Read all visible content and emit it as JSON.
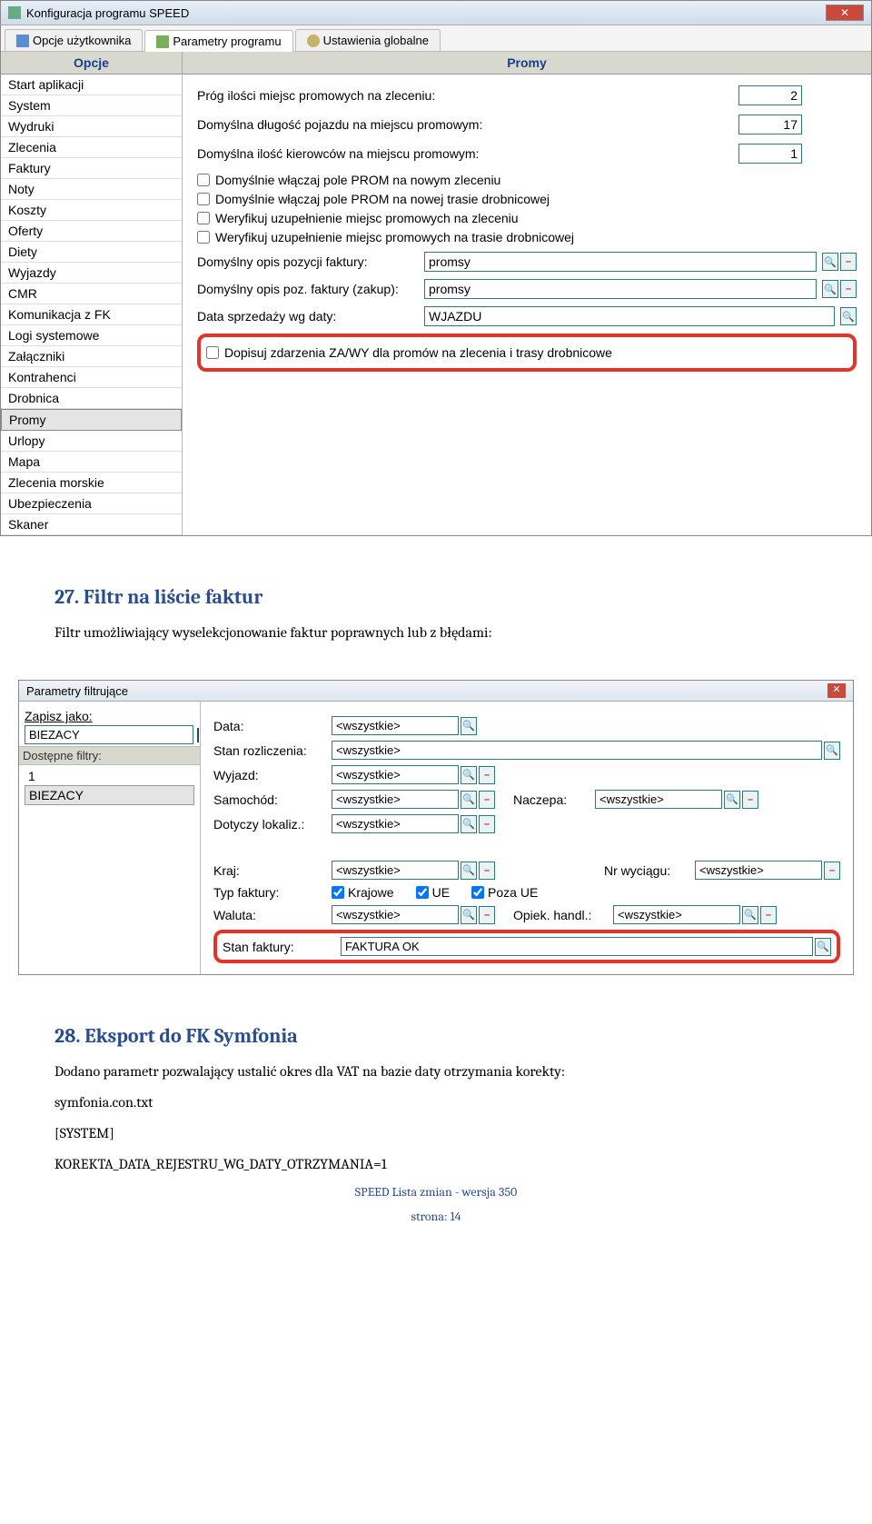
{
  "win1": {
    "title": "Konfiguracja programu SPEED",
    "tabs": [
      "Opcje użytkownika",
      "Parametry programu",
      "Ustawienia globalne"
    ],
    "col_headers": [
      "Opcje",
      "Promy"
    ],
    "sidebar": [
      "Start aplikacji",
      "System",
      "Wydruki",
      "Zlecenia",
      "Faktury",
      "Noty",
      "Koszty",
      "Oferty",
      "Diety",
      "Wyjazdy",
      "CMR",
      "Komunikacja z FK",
      "Logi systemowe",
      "Załączniki",
      "Kontrahenci",
      "Drobnica",
      "Promy",
      "Urlopy",
      "Mapa",
      "Zlecenia morskie",
      "Ubezpieczenia",
      "Skaner"
    ],
    "form": {
      "r1": {
        "label": "Próg ilości miejsc promowych na zleceniu:",
        "val": "2"
      },
      "r2": {
        "label": "Domyślna długość pojazdu na miejscu promowym:",
        "val": "17"
      },
      "r3": {
        "label": "Domyślna ilość kierowców na miejscu promowym:",
        "val": "1"
      },
      "c1": "Domyślnie włączaj pole PROM na nowym zleceniu",
      "c2": "Domyślnie włączaj pole PROM na nowej trasie drobnicowej",
      "c3": "Weryfikuj uzupełnienie miejsc promowych na zleceniu",
      "c4": "Weryfikuj uzupełnienie miejsc promowych na trasie drobnicowej",
      "t1": {
        "label": "Domyślny opis pozycji faktury:",
        "val": "promsy"
      },
      "t2": {
        "label": "Domyślny opis poz. faktury (zakup):",
        "val": "promsy"
      },
      "t3": {
        "label": "Data sprzedaży wg daty:",
        "val": "WJAZDU"
      },
      "c5": "Dopisuj zdarzenia ZA/WY dla promów na zlecenia i trasy drobnicowe"
    }
  },
  "doc": {
    "h27": "27. Filtr na liście faktur",
    "p27": "Filtr umożliwiający wyselekcjonowanie faktur poprawnych lub z błędami:",
    "h28": "28. Eksport do FK Symfonia",
    "p28a": "Dodano parametr pozwalający ustalić okres dla VAT na bazie daty otrzymania korekty:",
    "p28b": "symfonia.con.txt",
    "p28c": "[SYSTEM]",
    "p28d": "KOREKTA_DATA_REJESTRU_WG_DATY_OTRZYMANIA=1",
    "footer1": "SPEED Lista zmian - wersja 350",
    "footer2": "strona: 14"
  },
  "win2": {
    "title": "Parametry filtrujące",
    "side": {
      "zapisz": "Zapisz jako:",
      "biezacy": "BIEZACY",
      "dostepne": "Dostępne filtry:",
      "items": [
        "1",
        "BIEZACY"
      ]
    },
    "main": {
      "all": "<wszystkie>",
      "data": "Data:",
      "stan_roz": "Stan rozliczenia:",
      "wyjazd": "Wyjazd:",
      "samochod": "Samochód:",
      "naczepa": "Naczepa:",
      "dotyczy": "Dotyczy lokaliz.:",
      "kraj": "Kraj:",
      "nr_wyc": "Nr wyciągu:",
      "typ_fak": "Typ faktury:",
      "krajowe": "Krajowe",
      "ue": "UE",
      "poza_ue": "Poza UE",
      "waluta": "Waluta:",
      "opiek": "Opiek. handl.:",
      "stan_fak": "Stan faktury:",
      "faktura_ok": "FAKTURA OK"
    }
  }
}
